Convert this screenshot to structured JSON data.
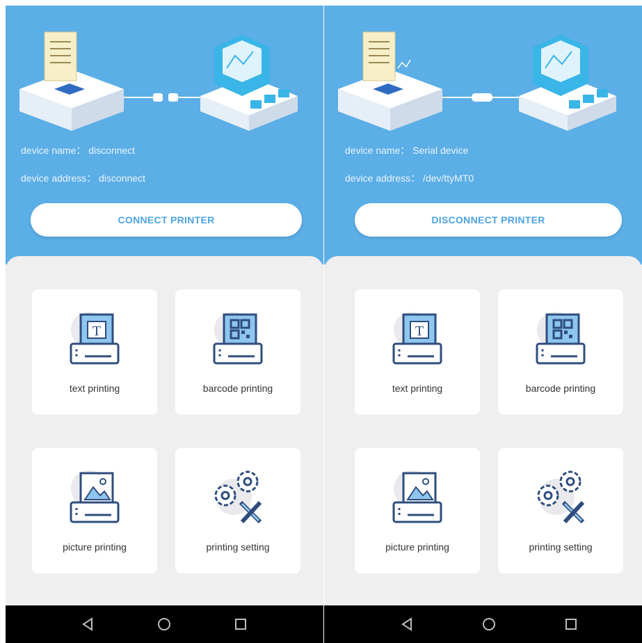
{
  "screens": [
    {
      "device_name": "device name： disconnect",
      "device_address": "device address： disconnect",
      "action_button": "CONNECT PRINTER",
      "cards": [
        {
          "label": "text printing",
          "icon": "text-print-icon"
        },
        {
          "label": "barcode printing",
          "icon": "barcode-print-icon"
        },
        {
          "label": "picture printing",
          "icon": "picture-print-icon"
        },
        {
          "label": "printing setting",
          "icon": "settings-icon"
        }
      ]
    },
    {
      "device_name": "device name： Serial device",
      "device_address": "device address： /dev/ttyMT0",
      "action_button": "DISCONNECT PRINTER",
      "cards": [
        {
          "label": "text printing",
          "icon": "text-print-icon"
        },
        {
          "label": "barcode printing",
          "icon": "barcode-print-icon"
        },
        {
          "label": "picture printing",
          "icon": "picture-print-icon"
        },
        {
          "label": "printing setting",
          "icon": "settings-icon"
        }
      ]
    }
  ],
  "navbar": {
    "back_icon": "back-icon",
    "home_icon": "home-icon",
    "recents_icon": "recents-icon"
  },
  "colors": {
    "header_blue": "#5baee6",
    "button_text": "#4da3e2",
    "content_bg": "#efefef",
    "icon_stroke": "#2f4d7c",
    "icon_fill": "#8ec6f0"
  }
}
